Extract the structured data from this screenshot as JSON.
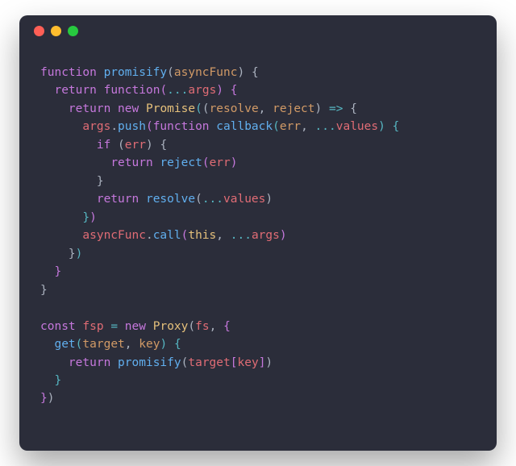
{
  "window": {
    "dots": [
      "red",
      "yellow",
      "green"
    ]
  },
  "code": {
    "kw_function": "function",
    "kw_return": "return",
    "kw_new": "new",
    "kw_if": "if",
    "kw_const": "const",
    "kw_this": "this",
    "fn_promisify": "promisify",
    "fn_function": "function",
    "fn_push": "push",
    "fn_callback": "callback",
    "fn_reject": "reject",
    "fn_resolve": "resolve",
    "fn_call": "call",
    "fn_get": "get",
    "cls_Promise": "Promise",
    "cls_Proxy": "Proxy",
    "id_asyncFunc": "asyncFunc",
    "id_args": "args",
    "id_resolve": "resolve",
    "id_reject": "reject",
    "id_err": "err",
    "id_values": "values",
    "id_fsp": "fsp",
    "id_fs": "fs",
    "id_target": "target",
    "id_key": "key",
    "op_spread": "...",
    "op_arrow": "=>",
    "op_eq": "=",
    "pn_lparen": "(",
    "pn_rparen": ")",
    "pn_lbrace": "{",
    "pn_rbrace": "}",
    "pn_lbrack": "[",
    "pn_rbrack": "]",
    "pn_comma": ",",
    "pn_dot": "."
  }
}
